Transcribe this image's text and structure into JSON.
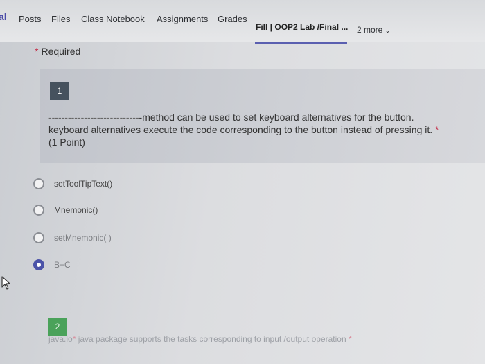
{
  "nav": {
    "team_fragment": "al",
    "tabs": [
      "Posts",
      "Files",
      "Class Notebook",
      "Assignments",
      "Grades"
    ],
    "active_tab": "Fill | OOP2 Lab /Final ...",
    "more": "2 more"
  },
  "required_label": "Required",
  "question1": {
    "number": "1",
    "blank": "----------------------------",
    "line1": "-method can be used to set keyboard alternatives for the button.",
    "line2": "keyboard alternatives execute the code corresponding to the button instead of pressing it.",
    "points": "(1 Point)",
    "options": [
      {
        "label": "setToolTipText()",
        "selected": false
      },
      {
        "label": "Mnemonic()",
        "selected": false
      },
      {
        "label": "setMnemonic( )",
        "selected": false
      },
      {
        "label": "B+C",
        "selected": true
      }
    ]
  },
  "question2": {
    "number": "2",
    "blank": "java.io",
    "text": " java package supports the tasks corresponding to input /output operation"
  },
  "colors": {
    "accent": "#4b53a8",
    "required": "#c4314b",
    "q1_badge": "#46525e",
    "q2_badge": "#4aa25a"
  }
}
